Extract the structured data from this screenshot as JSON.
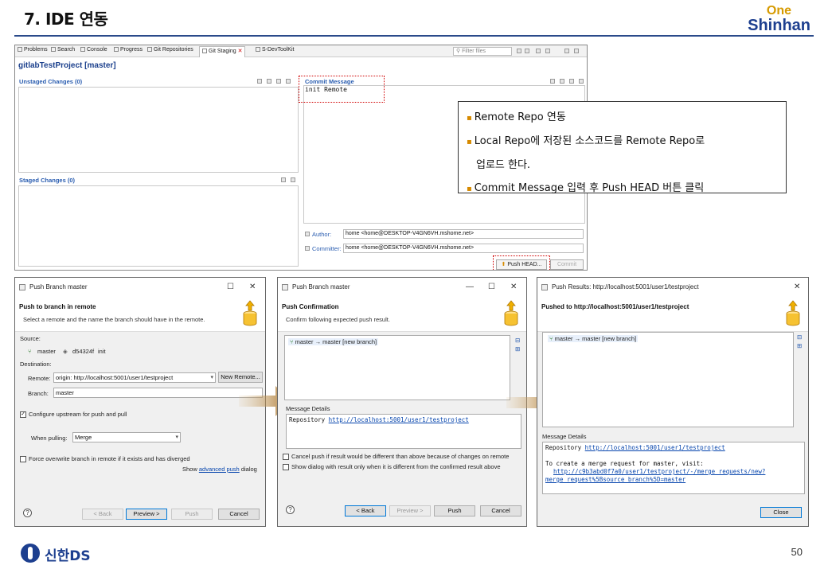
{
  "slide": {
    "title": "7. IDE 연동",
    "brand_top": "One",
    "brand_bottom": "Shinhan",
    "footer_logo": "신한DS",
    "page_number": "50"
  },
  "eclipse": {
    "tabs": [
      "Problems",
      "Search",
      "Console",
      "Progress",
      "Git Repositories",
      "Git Staging",
      "S-DevToolKit"
    ],
    "active_tab": "Git Staging",
    "filter_placeholder": "Filter files",
    "project_title": "gitlabTestProject [master]",
    "unstaged_label": "Unstaged Changes (0)",
    "staged_label": "Staged Changes (0)",
    "commit_message_label": "Commit Message",
    "commit_message_text": "init Remote",
    "author_label": "Author:",
    "author_value": "home <home@DESKTOP-V4GN6VH.mshome.net>",
    "committer_label": "Committer:",
    "committer_value": "home <home@DESKTOP-V4GN6VH.mshome.net>",
    "push_head_button": "Push HEAD...",
    "commit_button": "Commit"
  },
  "callout": {
    "line1": "Remote Repo 연동",
    "line2": "Local Repo에 저장된 소스코드를 Remote Repo로",
    "line3": "업로드 한다.",
    "line4": "Commit Message 입력 후 Push HEAD 버튼 클릭",
    "bullet_color": "#d68a00"
  },
  "dialog1": {
    "window_title": "Push Branch master",
    "header_title": "Push to branch in remote",
    "header_desc": "Select a remote and the name the branch should have in the remote.",
    "source_label": "Source:",
    "source_branch": "master",
    "source_commit": "d54324f",
    "source_msg": "init",
    "destination_label": "Destination:",
    "remote_label": "Remote:",
    "remote_value": "origin: http://localhost:5001/user1/testproject",
    "new_remote_button": "New Remote...",
    "branch_label": "Branch:",
    "branch_value": "master",
    "configure_upstream": "Configure upstream for push and pull",
    "when_pulling_label": "When pulling:",
    "when_pulling_value": "Merge",
    "force_overwrite": "Force overwrite branch in remote if it exists and has diverged",
    "show_prefix": "Show",
    "advanced_push_link": "advanced push",
    "show_suffix": "dialog",
    "back_button": "< Back",
    "preview_button": "Preview >",
    "push_button": "Push",
    "cancel_button": "Cancel"
  },
  "dialog2": {
    "window_title": "Push Branch master",
    "header_title": "Push Confirmation",
    "header_desc": "Confirm following expected push result.",
    "result_item": "master → master [new branch]",
    "message_details_label": "Message Details",
    "repository_label": "Repository",
    "repository_url": "http://localhost:5001/user1/testproject",
    "cancel_push_option": "Cancel push if result would be different than above because of changes on remote",
    "show_dialog_option": "Show dialog with result only when it is different from the confirmed result above",
    "back_button": "< Back",
    "preview_button": "Preview >",
    "push_button": "Push",
    "cancel_button": "Cancel"
  },
  "dialog3": {
    "window_title": "Push Results: http://localhost:5001/user1/testproject",
    "header_title": "Pushed to http://localhost:5001/user1/testproject",
    "result_item": "master → master [new branch]",
    "message_details_label": "Message Details",
    "repository_label": "Repository",
    "repository_url": "http://localhost:5001/user1/testproject",
    "merge_request_text": "To create a merge request for master, visit:",
    "merge_request_url_1": "http://c9b3abd0f7a0/user1/testproject/-/merge_requests/new?",
    "merge_request_url_2": "merge_request%5Bsource_branch%5D=master",
    "close_button": "Close"
  }
}
